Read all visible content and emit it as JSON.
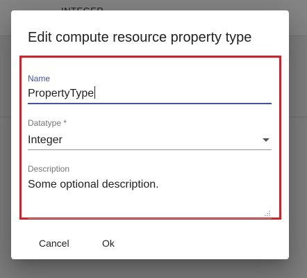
{
  "background": {
    "header_text": "INTEGER"
  },
  "dialog": {
    "title": "Edit compute resource property type",
    "fields": {
      "name": {
        "label": "Name",
        "value": "PropertyType"
      },
      "datatype": {
        "label": "Datatype *",
        "value": "Integer"
      },
      "description": {
        "label": "Description",
        "value": "Some optional description."
      }
    },
    "actions": {
      "cancel_label": "Cancel",
      "ok_label": "Ok"
    }
  },
  "colors": {
    "accent": "#3f51b5",
    "highlight": "#e01b24"
  },
  "icons": {
    "datatype_dropdown": "chevron-down-icon",
    "description_resize": "resize-grip-icon"
  }
}
